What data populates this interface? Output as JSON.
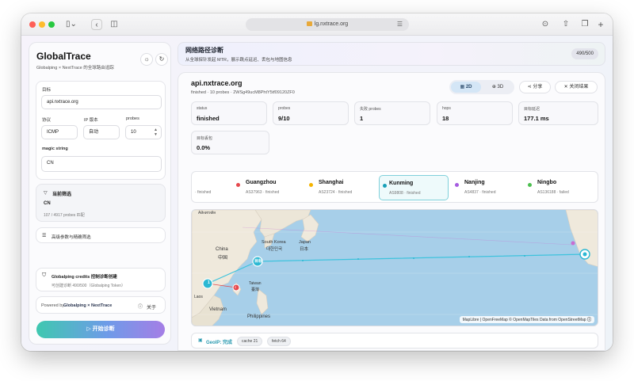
{
  "browser": {
    "url": "lg.nxtrace.org"
  },
  "sidebar": {
    "title": "GlobalTrace",
    "subtitle": "Globalping × NextTrace 的全球路由追踪",
    "target_label": "目标",
    "target_value": "api.nxtrace.org",
    "protocol_label": "协议",
    "protocol_value": "ICMP",
    "ipver_label": "IP 版本",
    "ipver_value": "自动",
    "probes_label": "probes",
    "probes_value": "10",
    "magic_label": "magic string",
    "magic_value": "CN",
    "filter_title": "当前筛选",
    "filter_value": "CN",
    "filter_count": "107 / 4917 probes 匹配",
    "advanced_label": "高级参数与精确筛选",
    "credits_title": "Globalping credits 控制诊断创建",
    "credits_sub": "可创建诊断 490/500（Globalping Token）",
    "powered_prefix": "Powered by ",
    "powered_brand": "Globalping × NextTrace",
    "about_label": "关于",
    "start_label": "开始诊断"
  },
  "header": {
    "title": "网络路径诊断",
    "subtitle": "从全球探针发起 MTR，展示跳点延迟、丢包与地图信息",
    "quota": "490/500"
  },
  "result": {
    "title": "api.nxtrace.org",
    "subtitle": "finished · 10 probes · 2WSg49ucM8PhtY5tf09120ZF0",
    "view_2d": "2D",
    "view_3d": "3D",
    "share_label": "分享",
    "close_label": "关闭结果",
    "stats": [
      {
        "k": "status",
        "v": "finished"
      },
      {
        "k": "probes",
        "v": "9/10"
      },
      {
        "k": "失败 probes",
        "v": "1"
      },
      {
        "k": "hops",
        "v": "18"
      },
      {
        "k": "目标延迟",
        "v": "177.1 ms"
      },
      {
        "k": "目标丢包",
        "v": "0.0%"
      }
    ],
    "hop_partial": "· finished",
    "hops": [
      {
        "name": "Guangzhou",
        "meta": "AS37963 · finished",
        "color": "#e5484d"
      },
      {
        "name": "Shanghai",
        "meta": "AS23724 · finished",
        "color": "#f5b400"
      },
      {
        "name": "Kunming",
        "meta": "AS9808 · finished",
        "color": "#18a0b8"
      },
      {
        "name": "Nanjing",
        "meta": "AS4837 · finished",
        "color": "#a65ce0"
      },
      {
        "name": "Ningbo",
        "meta": "AS136188 · failed",
        "color": "#4cbf4f"
      }
    ],
    "map_labels": {
      "china": "China",
      "china_cn": "中国",
      "south_korea": "South Korea",
      "south_korea_cn": "대한민국",
      "japan": "Japan",
      "japan_cn": "日本",
      "taiwan": "Taiwan",
      "taiwan_cn": "臺灣",
      "vietnam": "Vietnam",
      "philippines": "Philippines",
      "laos": "Laos",
      "top_left": "Айнитийн",
      "marker_1": "1",
      "marker_2": "2",
      "marker_3": "目标"
    },
    "attribution": "MapLibre | OpenFreeMap © OpenMapTiles Data from OpenStreetMap",
    "footer_geoip": "GeoIP: 完成",
    "footer_cache": "cache 21",
    "footer_fetch": "fetch 64"
  }
}
